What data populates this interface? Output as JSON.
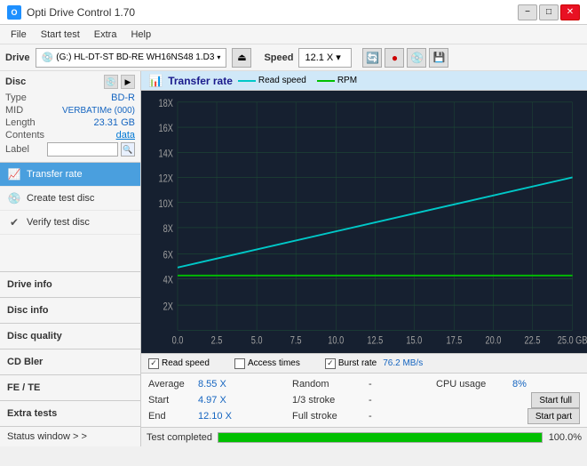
{
  "titleBar": {
    "icon": "O",
    "title": "Opti Drive Control 1.70",
    "minimize": "−",
    "maximize": "□",
    "close": "✕"
  },
  "menuBar": {
    "items": [
      "File",
      "Start test",
      "Extra",
      "Help"
    ]
  },
  "driveBar": {
    "driveLabel": "Drive",
    "driveValue": "(G:)  HL-DT-ST BD-RE  WH16NS48 1.D3",
    "speedLabel": "Speed",
    "speedValue": "12.1 X  ▾"
  },
  "disc": {
    "title": "Disc",
    "typeLabel": "Type",
    "typeValue": "BD-R",
    "midLabel": "MID",
    "midValue": "VERBATIMe (000)",
    "lengthLabel": "Length",
    "lengthValue": "23.31 GB",
    "contentsLabel": "Contents",
    "contentsValue": "data",
    "labelLabel": "Label",
    "labelValue": ""
  },
  "nav": {
    "items": [
      {
        "id": "transfer-rate",
        "label": "Transfer rate",
        "icon": "📊",
        "active": true
      },
      {
        "id": "create-test-disc",
        "label": "Create test disc",
        "icon": "💿",
        "active": false
      },
      {
        "id": "verify-test-disc",
        "label": "Verify test disc",
        "icon": "✔",
        "active": false
      }
    ]
  },
  "driveInfo": {
    "label": "Drive info"
  },
  "feTE": {
    "label": "FE / TE"
  },
  "extraTests": {
    "label": "Extra tests"
  },
  "statusWindow": {
    "label": "Status window > >"
  },
  "chart": {
    "title": "Transfer rate",
    "legend": {
      "readLabel": "Read speed",
      "rpmLabel": "RPM"
    },
    "xAxis": [
      "0.0",
      "2.5",
      "5.0",
      "7.5",
      "10.0",
      "12.5",
      "15.0",
      "17.5",
      "20.0",
      "22.5",
      "25.0 GB"
    ],
    "yAxis": [
      "2X",
      "4X",
      "6X",
      "8X",
      "10X",
      "12X",
      "14X",
      "16X",
      "18X"
    ]
  },
  "statsBar": {
    "readSpeedLabel": "Read speed",
    "accessTimesLabel": "Access times",
    "burstRateLabel": "Burst rate",
    "burstRateValue": "76.2 MB/s"
  },
  "dataRows": [
    {
      "col1Label": "Average",
      "col1Value": "8.55 X",
      "col2Label": "Random",
      "col2Value": "-",
      "col3Label": "CPU usage",
      "col3Value": "8%",
      "btnLabel": ""
    },
    {
      "col1Label": "Start",
      "col1Value": "4.97 X",
      "col2Label": "1/3 stroke",
      "col2Value": "-",
      "col3Label": "",
      "col3Value": "",
      "btnLabel": "Start full"
    },
    {
      "col1Label": "End",
      "col1Value": "12.10 X",
      "col2Label": "Full stroke",
      "col2Value": "-",
      "col3Label": "",
      "col3Value": "",
      "btnLabel": "Start part"
    }
  ],
  "progressBar": {
    "statusLabel": "Test completed",
    "percent": "100.0%",
    "fillWidth": "100"
  },
  "colors": {
    "chartBg": "#162030",
    "gridLine": "#1e4030",
    "readLine": "#00c8c8",
    "rpmLine": "#00c000",
    "accent": "#4a9fde"
  }
}
